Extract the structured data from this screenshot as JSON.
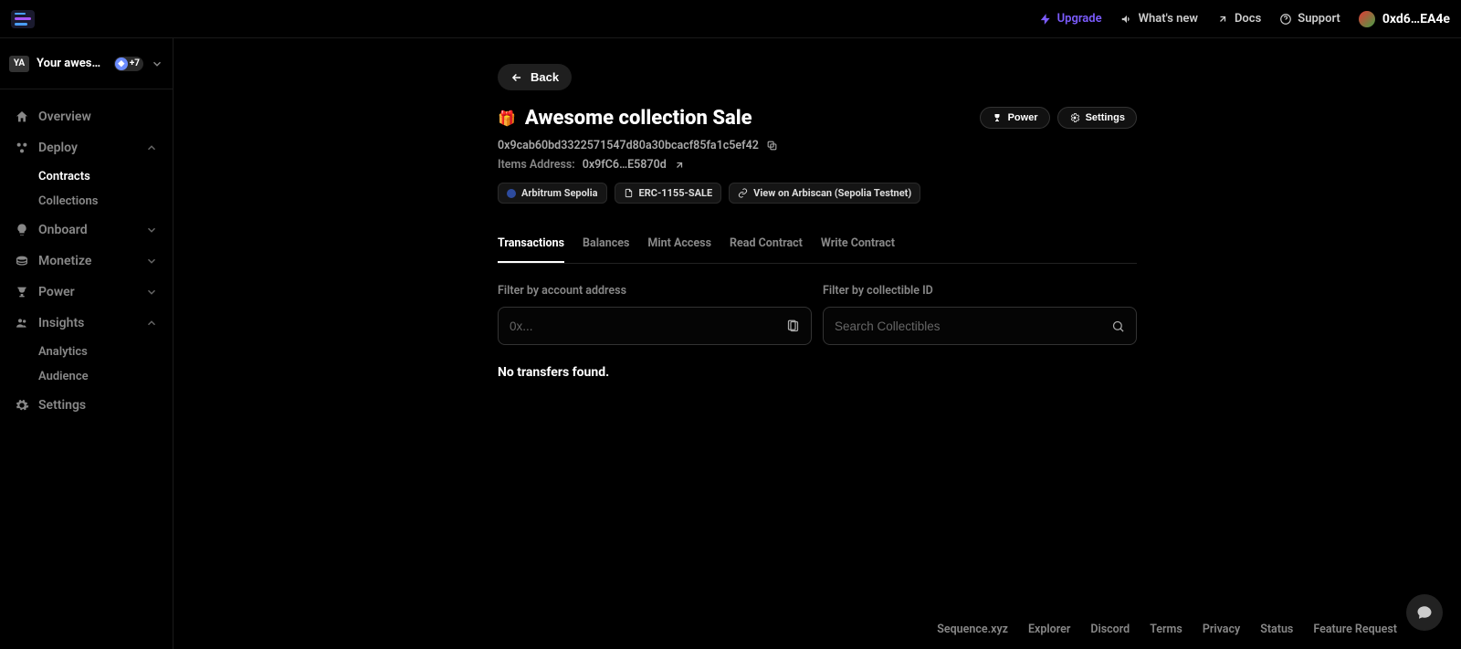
{
  "topbar": {
    "upgrade": "Upgrade",
    "whats_new": "What's new",
    "docs": "Docs",
    "support": "Support",
    "wallet": "0xd6…EA4e"
  },
  "sidebar": {
    "project_initials": "YA",
    "project_name": "Your aweso…",
    "chain_badge": "+7",
    "items": {
      "overview": "Overview",
      "deploy": "Deploy",
      "contracts": "Contracts",
      "collections": "Collections",
      "onboard": "Onboard",
      "monetize": "Monetize",
      "power": "Power",
      "insights": "Insights",
      "analytics": "Analytics",
      "audience": "Audience",
      "settings": "Settings"
    }
  },
  "page": {
    "back": "Back",
    "title_icon": "🎁",
    "title": "Awesome collection Sale",
    "power_btn": "Power",
    "settings_btn": "Settings",
    "contract_address": "0x9cab60bd3322571547d80a30bcacf85fa1c5ef42",
    "items_address_label": "Items Address:",
    "items_address": "0x9fC6…E5870d",
    "chips": {
      "network": "Arbitrum Sepolia",
      "standard": "ERC-1155-SALE",
      "explorer": "View on Arbiscan (Sepolia Testnet)"
    },
    "tabs": [
      "Transactions",
      "Balances",
      "Mint Access",
      "Read Contract",
      "Write Contract"
    ],
    "filters": {
      "account_label": "Filter by account address",
      "account_placeholder": "0x...",
      "collectible_label": "Filter by collectible ID",
      "collectible_placeholder": "Search Collectibles"
    },
    "empty": "No transfers found."
  },
  "footer": {
    "links": [
      "Sequence.xyz",
      "Explorer",
      "Discord",
      "Terms",
      "Privacy",
      "Status",
      "Feature Request"
    ]
  }
}
